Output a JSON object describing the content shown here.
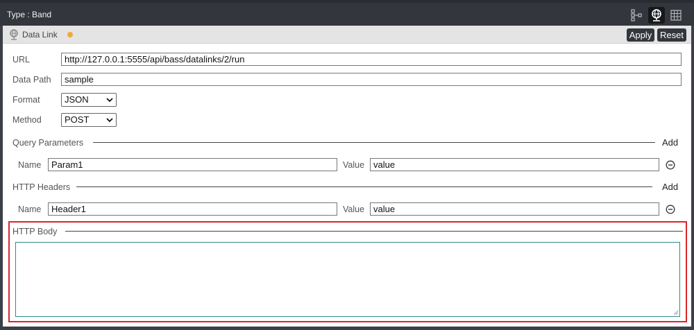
{
  "window": {
    "title": "Type : Band"
  },
  "toolbar_icons": [
    "tree-icon",
    "globe-icon",
    "grid-icon"
  ],
  "subbar": {
    "label": "Data Link",
    "apply": "Apply",
    "reset": "Reset",
    "status_dot_color": "#f0a83a"
  },
  "form": {
    "url_label": "URL",
    "url_value": "http://127.0.0.1:5555/api/bass/datalinks/2/run",
    "data_path_label": "Data Path",
    "data_path_value": "sample",
    "format_label": "Format",
    "format_value": "JSON",
    "method_label": "Method",
    "method_value": "POST"
  },
  "query_params": {
    "title": "Query Parameters",
    "add": "Add",
    "rows": [
      {
        "name_label": "Name",
        "name": "Param1",
        "value_label": "Value",
        "value": "value"
      }
    ]
  },
  "http_headers": {
    "title": "HTTP Headers",
    "add": "Add",
    "rows": [
      {
        "name_label": "Name",
        "name": "Header1",
        "value_label": "Value",
        "value": "value"
      }
    ]
  },
  "http_body": {
    "title": "HTTP Body",
    "value": ""
  }
}
